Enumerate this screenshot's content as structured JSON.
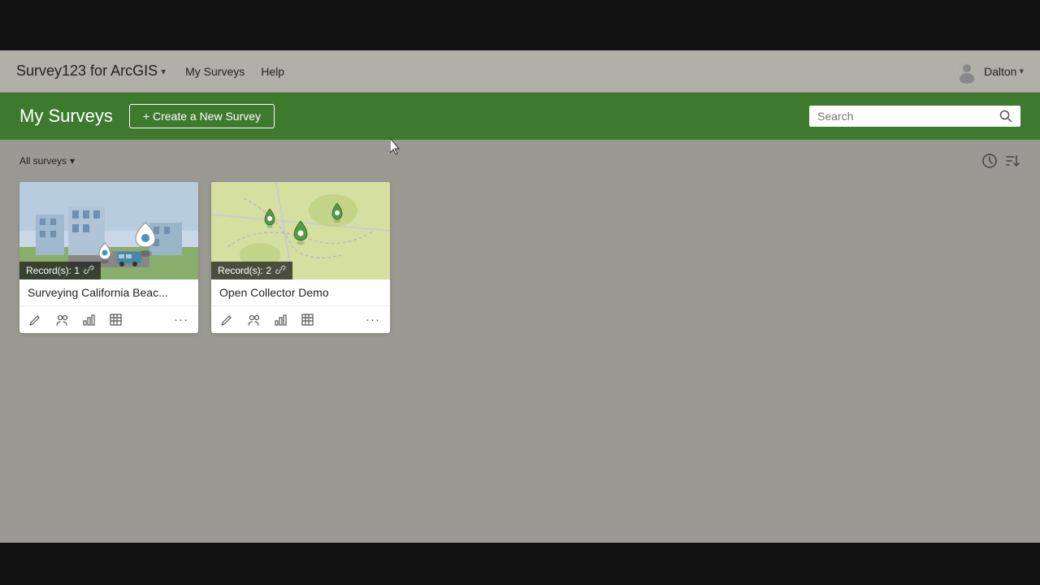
{
  "app": {
    "title": "Survey123 for ArcGIS",
    "dropdown_arrow": "▾"
  },
  "nav": {
    "my_surveys_link": "My Surveys",
    "help_link": "Help"
  },
  "user": {
    "name": "Dalton",
    "dropdown_arrow": "▾"
  },
  "header": {
    "page_title": "My Surveys",
    "create_button_label": "+ Create a New Survey",
    "search_placeholder": "Search"
  },
  "filter": {
    "label": "All surveys",
    "dropdown_arrow": "▾"
  },
  "surveys": [
    {
      "id": "survey-1",
      "title": "Surveying California Beac...",
      "records_label": "Record(s): 1",
      "thumbnail_type": "city"
    },
    {
      "id": "survey-2",
      "title": "Open Collector Demo",
      "records_label": "Record(s): 2",
      "thumbnail_type": "map"
    }
  ],
  "card_actions": {
    "edit": "✏",
    "share": "🔗",
    "chart": "📊",
    "table": "📋",
    "more": "···"
  },
  "icons": {
    "search": "🔍",
    "clock": "🕐",
    "sort": "⇅",
    "link": "🔗"
  }
}
